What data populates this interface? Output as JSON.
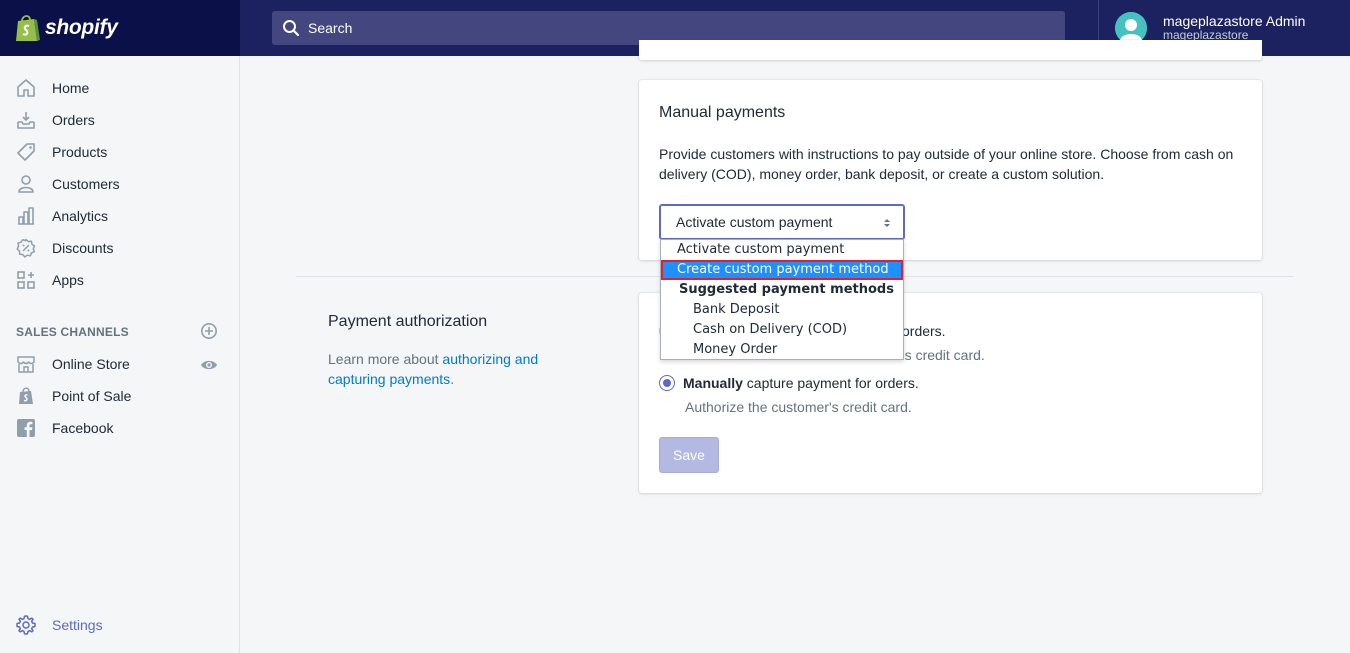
{
  "app": {
    "name": "shopify"
  },
  "search": {
    "placeholder": "Search"
  },
  "user": {
    "name": "mageplazastore Admin",
    "store": "mageplazastore"
  },
  "sidebar": {
    "items": [
      {
        "label": "Home",
        "icon": "home-icon"
      },
      {
        "label": "Orders",
        "icon": "orders-icon"
      },
      {
        "label": "Products",
        "icon": "tag-icon"
      },
      {
        "label": "Customers",
        "icon": "person-icon"
      },
      {
        "label": "Analytics",
        "icon": "bar-chart-icon"
      },
      {
        "label": "Discounts",
        "icon": "discount-icon"
      },
      {
        "label": "Apps",
        "icon": "apps-icon"
      }
    ],
    "sales_channels_heading": "SALES CHANNELS",
    "channels": [
      {
        "label": "Online Store",
        "icon": "store-icon"
      },
      {
        "label": "Point of Sale",
        "icon": "pos-icon"
      },
      {
        "label": "Facebook",
        "icon": "facebook-icon"
      }
    ],
    "settings_label": "Settings"
  },
  "manual_payments": {
    "title": "Manual payments",
    "description": "Provide customers with instructions to pay outside of your online store. Choose from cash on delivery (COD), money order, bank deposit, or create a custom solution.",
    "select_value": "Activate custom payment",
    "options": {
      "activate": "Activate custom payment",
      "create": "Create custom payment method",
      "group": "Suggested payment methods",
      "bank": "Bank Deposit",
      "cod": "Cash on Delivery (COD)",
      "money": "Money Order"
    }
  },
  "payment_authorization": {
    "title": "Payment authorization",
    "learn_prefix": "Learn more about ",
    "learn_link_1": "authorizing and",
    "learn_link_2": "capturing payments",
    "learn_suffix": ".",
    "auto_tail": "orders.",
    "auto_help_tail": "'s credit card.",
    "manual_bold": "Manually",
    "manual_rest": " capture payment for orders.",
    "manual_help": "Authorize the customer's credit card.",
    "save_label": "Save"
  },
  "colors": {
    "topbar": "#1c2260",
    "brand": "#0b1148",
    "accent": "#5c6ac4",
    "link": "#007ace",
    "selected_option": "#1e90ff",
    "highlight_border": "#e0202a"
  }
}
